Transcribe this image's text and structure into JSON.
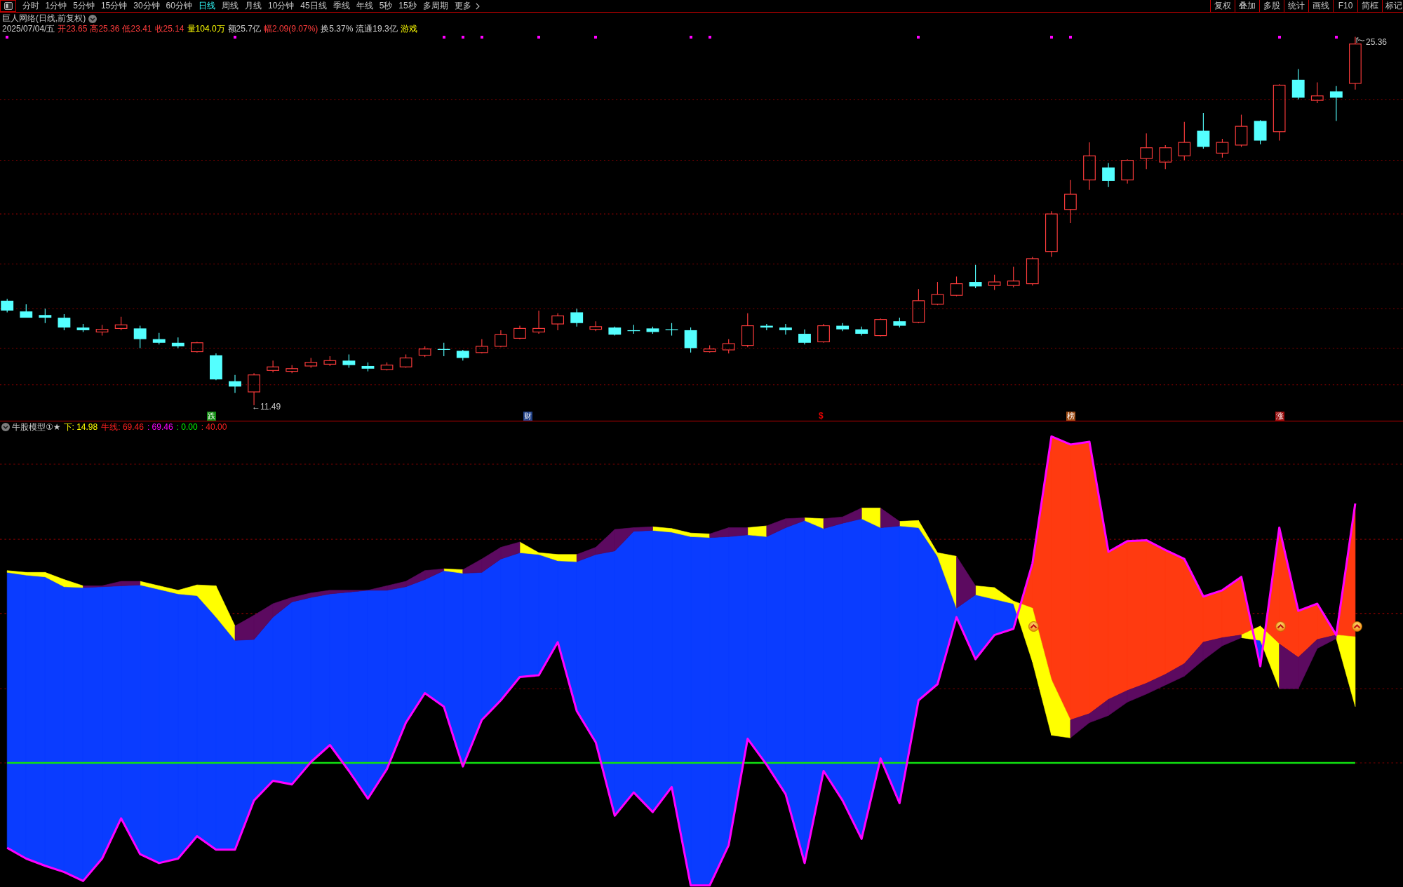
{
  "toolbar": {
    "periods": [
      {
        "label": "分时",
        "selected": false
      },
      {
        "label": "1分钟",
        "selected": false
      },
      {
        "label": "5分钟",
        "selected": false
      },
      {
        "label": "15分钟",
        "selected": false
      },
      {
        "label": "30分钟",
        "selected": false
      },
      {
        "label": "60分钟",
        "selected": false
      },
      {
        "label": "日线",
        "selected": true
      },
      {
        "label": "周线",
        "selected": false
      },
      {
        "label": "月线",
        "selected": false
      },
      {
        "label": "10分钟",
        "selected": false
      },
      {
        "label": "45日线",
        "selected": false
      },
      {
        "label": "季线",
        "selected": false
      },
      {
        "label": "年线",
        "selected": false
      },
      {
        "label": "5秒",
        "selected": false
      },
      {
        "label": "15秒",
        "selected": false
      },
      {
        "label": "多周期",
        "selected": false
      }
    ],
    "more": "更多",
    "tools": [
      "复权",
      "叠加",
      "多股",
      "统计",
      "画线",
      "F10",
      "简框",
      "标记"
    ]
  },
  "price_panel": {
    "title": "巨人网络(日线,前复权)",
    "quote": [
      {
        "text": "2025/07/04/五",
        "color": "#d0d0d0"
      },
      {
        "text": "开23.65",
        "color": "#ff3c3c"
      },
      {
        "text": "高25.36",
        "color": "#ff3c3c"
      },
      {
        "text": "低23.41",
        "color": "#ff3c3c"
      },
      {
        "text": "收25.14",
        "color": "#ff3c3c"
      },
      {
        "text": "量104.0万",
        "color": "#ffff00"
      },
      {
        "text": "额25.7亿",
        "color": "#d0d0d0"
      },
      {
        "text": "幅2.09(9.07%)",
        "color": "#ff3c3c"
      },
      {
        "text": "换5.37%",
        "color": "#d0d0d0"
      },
      {
        "text": "流通19.3亿",
        "color": "#d0d0d0"
      },
      {
        "text": "游戏",
        "color": "#ffff00"
      }
    ],
    "high_label": "25.36",
    "low_label": "←11.49",
    "markers": [
      {
        "label": "跌",
        "kind": "tag",
        "color": "#108a10"
      },
      {
        "label": "财",
        "kind": "tag",
        "color": "#1e3f86"
      },
      {
        "label": "$",
        "kind": "glyph",
        "color": "#e00000"
      },
      {
        "label": "榜",
        "kind": "tag",
        "color": "#9c4a12"
      },
      {
        "label": "涨",
        "kind": "tag",
        "color": "#9a0c0c"
      }
    ]
  },
  "indicator_panel": {
    "name": "牛股模型①★",
    "values": [
      {
        "text": "下: 14.98",
        "color": "#ffff00"
      },
      {
        "text": "牛线: 69.46",
        "color": "#ff2020"
      },
      {
        "text": ": 69.46",
        "color": "#ff00ff"
      },
      {
        "text": ": 0.00",
        "color": "#00ff00"
      },
      {
        "text": ": 40.00",
        "color": "#ff2020"
      }
    ]
  }
}
